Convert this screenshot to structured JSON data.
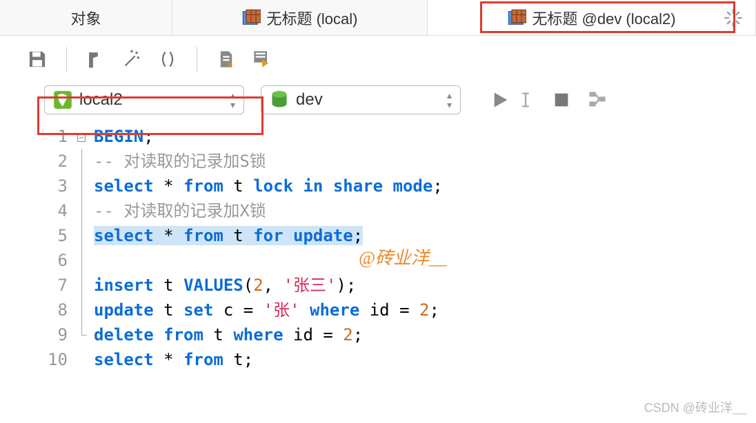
{
  "tabs": {
    "objects": "对象",
    "untitled_local": "无标题 (local)",
    "untitled_dev": "无标题 @dev (local2)"
  },
  "dropdowns": {
    "connection": "local2",
    "database": "dev"
  },
  "code": {
    "l1_begin": "BEGIN",
    "l1_semi": ";",
    "l2_comment": "-- 对读取的记录加S锁",
    "l3_a": "select",
    "l3_b": " * ",
    "l3_c": "from",
    "l3_d": " t ",
    "l3_e": "lock in share mode",
    "l3_f": ";",
    "l4_comment": "-- 对读取的记录加X锁",
    "l5_a": "select",
    "l5_b": " * ",
    "l5_c": "from",
    "l5_d": " t ",
    "l5_e": "for update",
    "l5_f": ";",
    "l7_a": "insert",
    "l7_b": " t ",
    "l7_c": "VALUES",
    "l7_d": "(",
    "l7_e": "2",
    "l7_f": ", ",
    "l7_g": "'张三'",
    "l7_h": ");",
    "l8_a": "update",
    "l8_b": " t ",
    "l8_c": "set",
    "l8_d": " c = ",
    "l8_e": "'张'",
    "l8_f": " ",
    "l8_g": "where",
    "l8_h": " id = ",
    "l8_i": "2",
    "l8_j": ";",
    "l9_a": "delete from",
    "l9_b": " t ",
    "l9_c": "where",
    "l9_d": " id = ",
    "l9_e": "2",
    "l9_f": ";",
    "l10_a": "select",
    "l10_b": " * ",
    "l10_c": "from",
    "l10_d": " t;"
  },
  "lines": [
    "1",
    "2",
    "3",
    "4",
    "5",
    "6",
    "7",
    "8",
    "9",
    "10"
  ],
  "watermark": "@砖业洋__",
  "csdn": "CSDN @砖业洋__"
}
